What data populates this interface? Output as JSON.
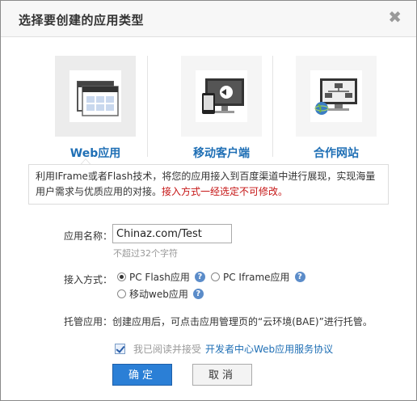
{
  "dialog": {
    "title": "选择要创建的应用类型",
    "close_symbol": "✖"
  },
  "types": [
    {
      "label": "Web应用",
      "icon": "web-app-icon",
      "active": true
    },
    {
      "label": "移动客户端",
      "icon": "mobile-client-icon",
      "active": false
    },
    {
      "label": "合作网站",
      "icon": "partner-site-icon",
      "active": false
    }
  ],
  "info": {
    "text": "利用IFrame或者Flash技术，将您的应用接入到百度渠道中进行展现，实现海量用户需求与优质应用的对接。",
    "warning": "接入方式一经选定不可修改。"
  },
  "form": {
    "name_label": "应用名称：",
    "name_value": "Chinaz.com/Test",
    "name_hint": "不超过32个字符",
    "access_label": "接入方式：",
    "access_options": [
      {
        "label": "PC Flash应用",
        "selected": true
      },
      {
        "label": "PC Iframe应用",
        "selected": false
      },
      {
        "label": "移动web应用",
        "selected": false
      }
    ],
    "hosting_text": "托管应用：创建应用后，可点击应用管理页的“云环境(BAE)”进行托管。",
    "agree_text": "我已阅读并接受",
    "agree_link": "开发者中心Web应用服务协议",
    "help_symbol": "?"
  },
  "buttons": {
    "ok": "确定",
    "cancel": "取消"
  },
  "colors": {
    "accent": "#1f6fb5",
    "primary_button": "#2b7fd6",
    "warning": "#c51414"
  }
}
